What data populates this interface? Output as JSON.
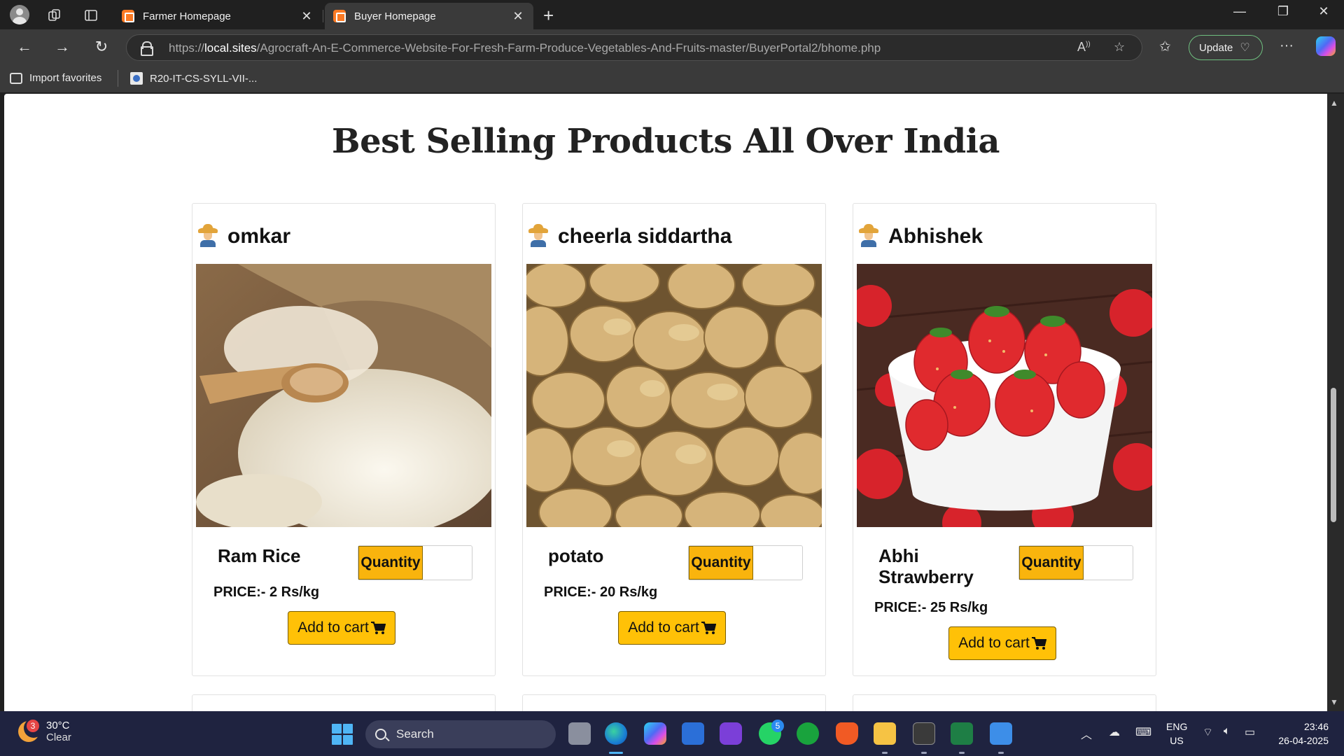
{
  "browser": {
    "tabs": [
      {
        "title": "Farmer Homepage",
        "active": false
      },
      {
        "title": "Buyer Homepage",
        "active": true
      }
    ],
    "url_prefix": "https://",
    "url_host": "local.sites",
    "url_path": "/Agrocraft-An-E-Commerce-Website-For-Fresh-Farm-Produce-Vegetables-And-Fruits-master/BuyerPortal2/bhome.php",
    "update_label": "Update",
    "favorites": [
      {
        "label": "Import favorites",
        "icon": "import-icon"
      },
      {
        "label": "R20-IT-CS-SYLL-VII-...",
        "icon": "page-favicon"
      }
    ]
  },
  "page": {
    "title": "Best Selling Products All Over India",
    "quantity_label": "Quantity",
    "cart_label": "Add to cart",
    "products": [
      {
        "farmer": "omkar",
        "name": "Ram Rice",
        "price": "PRICE:- 2 Rs/kg",
        "image": "rice-image"
      },
      {
        "farmer": "cheerla siddartha",
        "name": "potato",
        "price": "PRICE:- 20 Rs/kg",
        "image": "potato-image"
      },
      {
        "farmer": "Abhishek",
        "name": "Abhi Strawberry",
        "price": "PRICE:- 25 Rs/kg",
        "image": "strawberry-image"
      }
    ]
  },
  "taskbar": {
    "weather_temp": "30°C",
    "weather_desc": "Clear",
    "weather_badge": "3",
    "search_placeholder": "Search",
    "whatsapp_badge": "5",
    "lang_top": "ENG",
    "lang_bottom": "US",
    "time": "23:46",
    "date": "26-04-2025"
  },
  "colors": {
    "accent_yellow": "#ffc107",
    "quantity_bg": "#f9b40d",
    "browser_dark": "#202020",
    "taskbar": "#1f2340"
  }
}
